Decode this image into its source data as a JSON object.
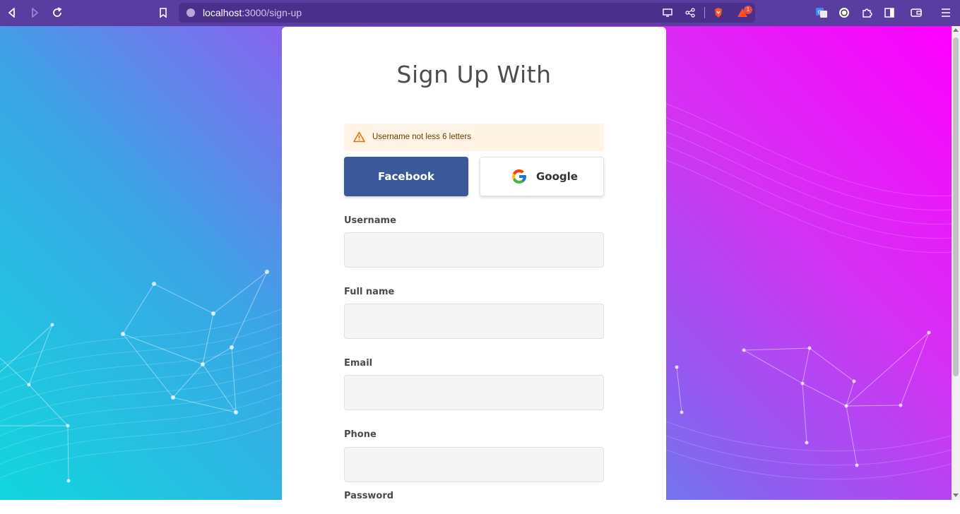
{
  "browser": {
    "url_host": "localhost",
    "url_path": ":3000/sign-up",
    "notification_count": "1",
    "icons": [
      "back-icon",
      "forward-icon",
      "reload-icon",
      "bookmark-icon",
      "info-icon",
      "cast-icon",
      "share-icon",
      "brave-shield-icon",
      "brave-rewards-icon",
      "translate-icon",
      "vpn-icon",
      "extensions-icon",
      "sidebar-icon",
      "wallet-icon",
      "menu-icon"
    ]
  },
  "form": {
    "title": "Sign Up With",
    "alert": "Username not less 6 letters",
    "facebook_label": "Facebook",
    "google_label": "Google",
    "fields": [
      {
        "label": "Username",
        "value": ""
      },
      {
        "label": "Full name",
        "value": ""
      },
      {
        "label": "Email",
        "value": ""
      },
      {
        "label": "Phone",
        "value": ""
      },
      {
        "label": "Password",
        "value": ""
      }
    ]
  },
  "colors": {
    "facebook": "#3b5998",
    "alert_bg": "#fff4e5",
    "alert_icon": "#ed6c02",
    "browser_bar": "#5a3da1"
  }
}
